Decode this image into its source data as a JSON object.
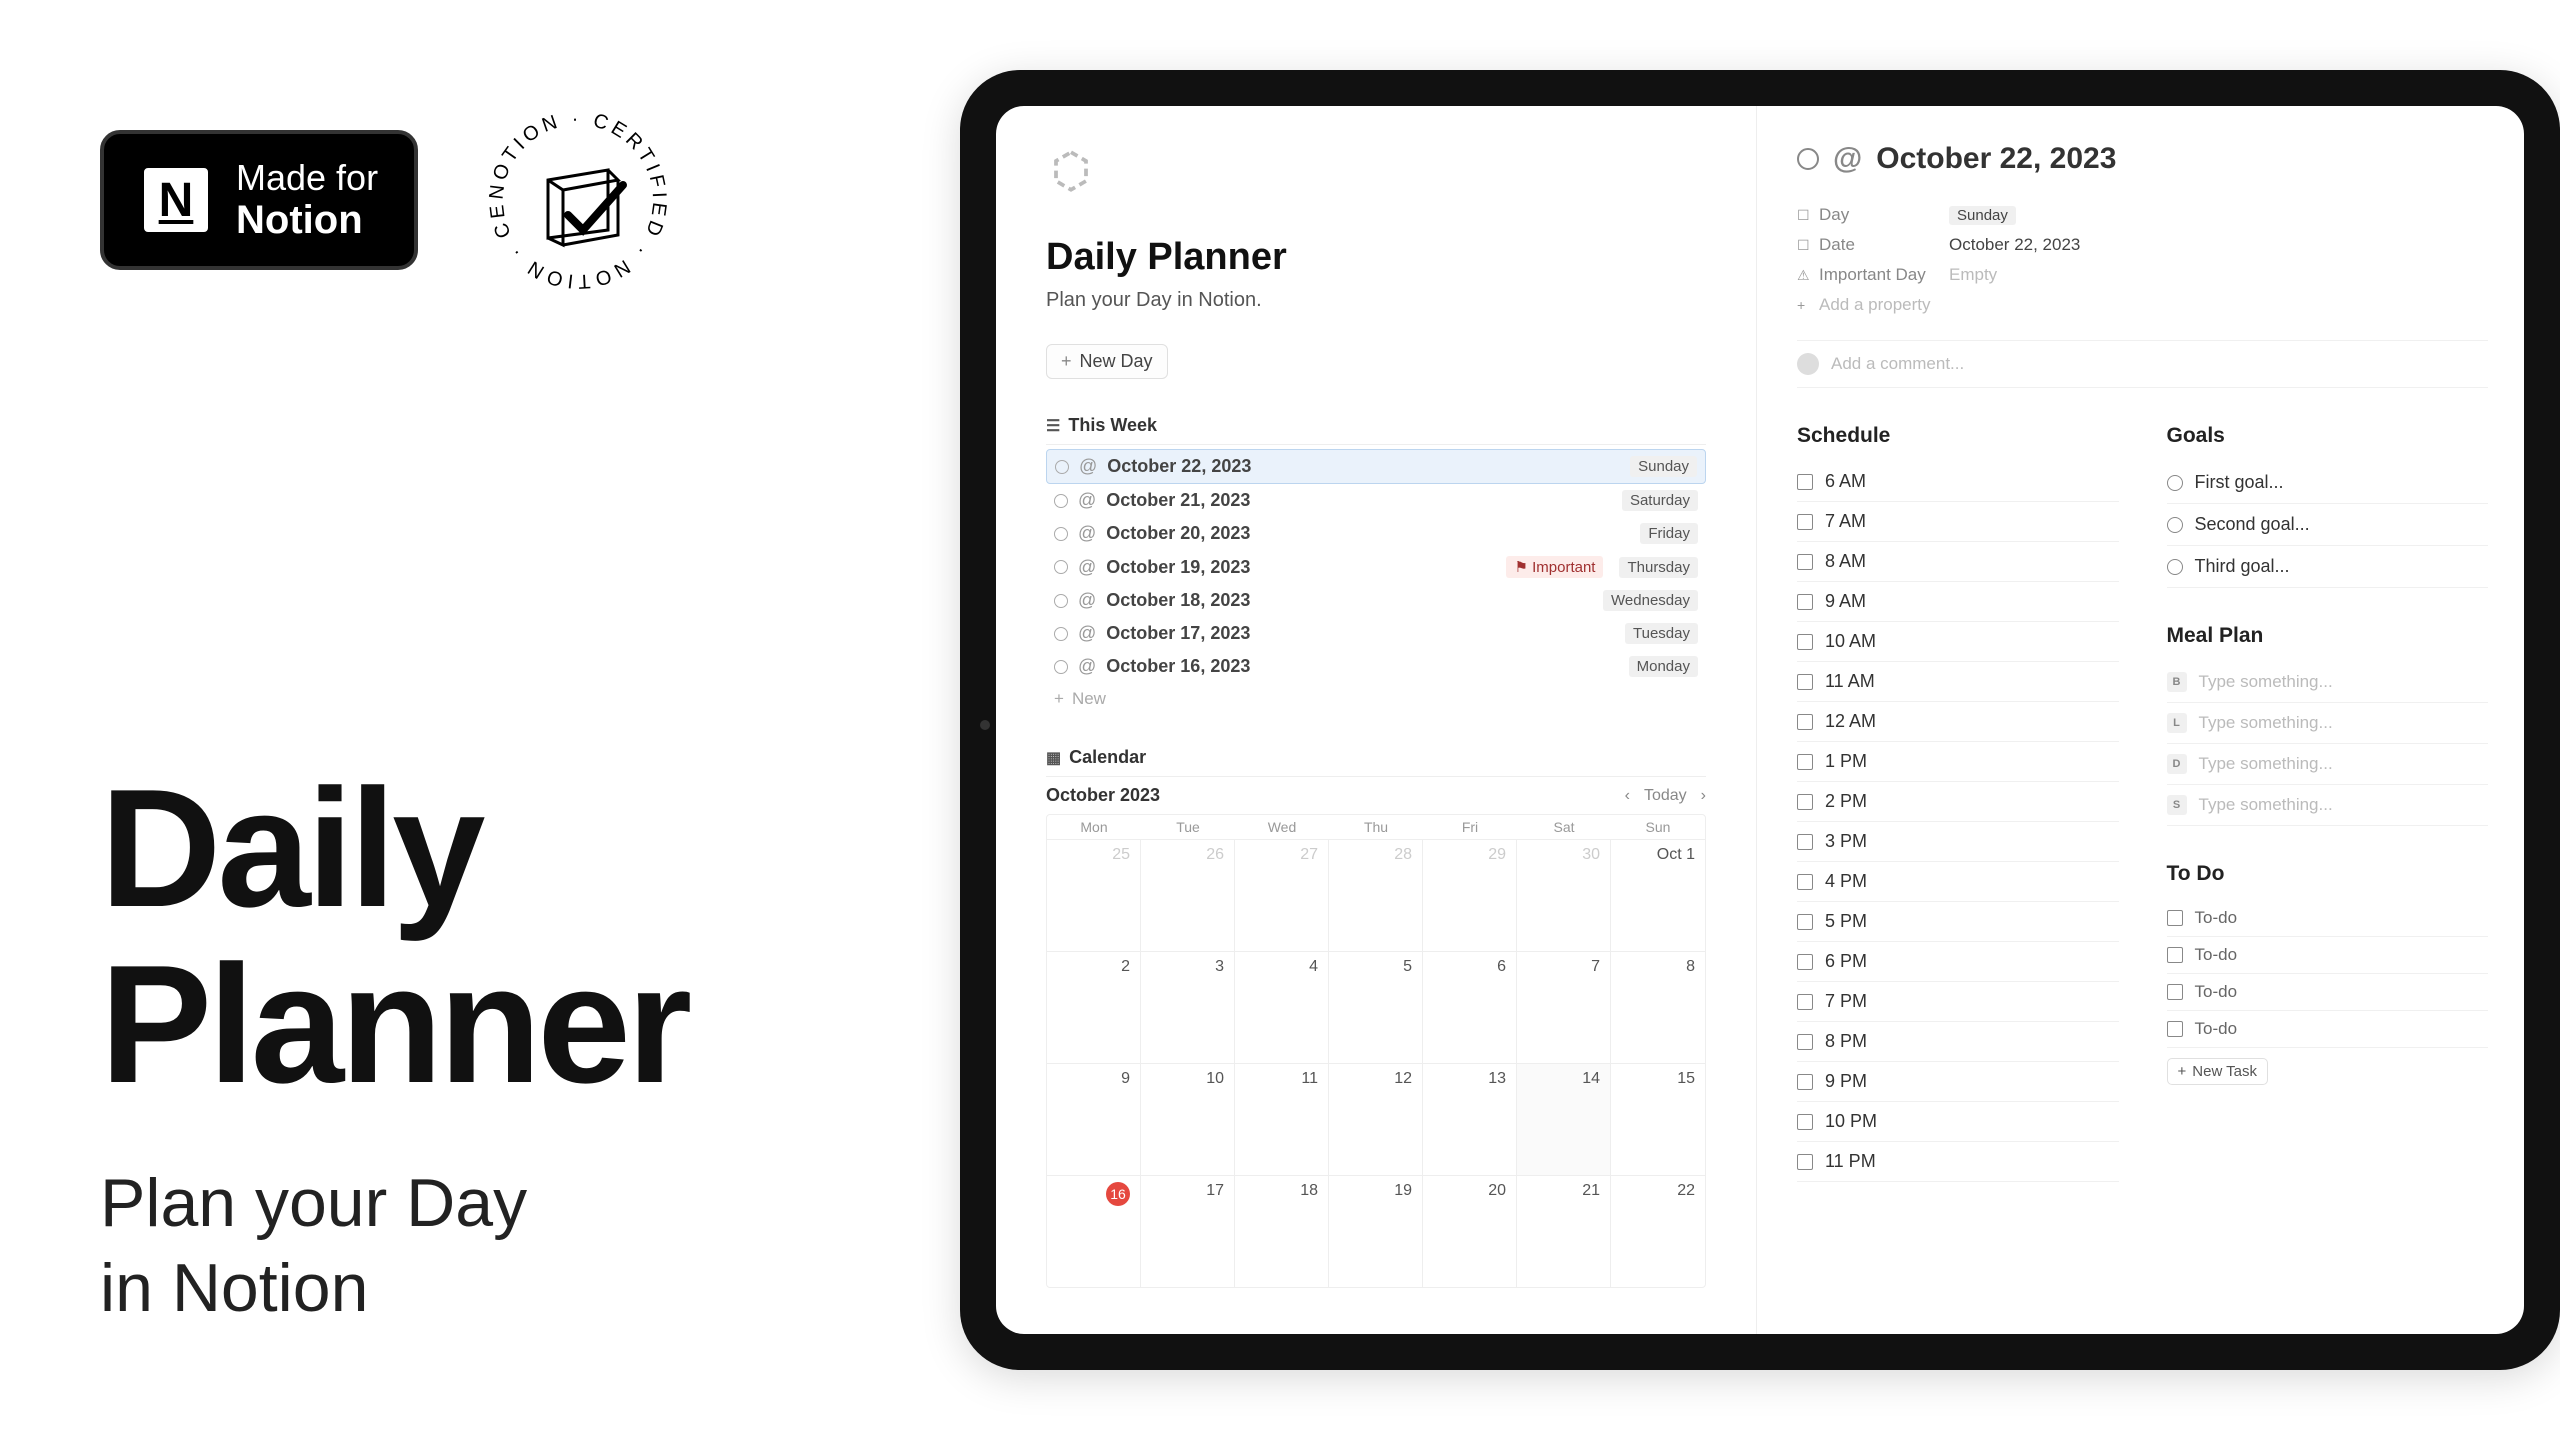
{
  "marketing": {
    "badge_made": "Made for",
    "badge_notion": "Notion",
    "hero_title1": "Daily",
    "hero_title2": "Planner",
    "hero_sub1": "Plan your Day",
    "hero_sub2": "in Notion"
  },
  "main": {
    "title": "Daily Planner",
    "subtitle": "Plan your Day in Notion.",
    "new_day": "New Day",
    "this_week": "This Week",
    "week": [
      {
        "date": "October 22, 2023",
        "day": "Sunday",
        "active": true
      },
      {
        "date": "October 21, 2023",
        "day": "Saturday"
      },
      {
        "date": "October 20, 2023",
        "day": "Friday"
      },
      {
        "date": "October 19, 2023",
        "day": "Thursday",
        "important": "Important"
      },
      {
        "date": "October 18, 2023",
        "day": "Wednesday"
      },
      {
        "date": "October 17, 2023",
        "day": "Tuesday"
      },
      {
        "date": "October 16, 2023",
        "day": "Monday"
      }
    ],
    "new_label": "New",
    "calendar_label": "Calendar",
    "month": "October 2023",
    "today": "Today",
    "daynames": [
      "Mon",
      "Tue",
      "Wed",
      "Thu",
      "Fri",
      "Sat",
      "Sun"
    ],
    "cells": [
      {
        "d": "25",
        "prev": true
      },
      {
        "d": "26",
        "prev": true
      },
      {
        "d": "27",
        "prev": true
      },
      {
        "d": "28",
        "prev": true
      },
      {
        "d": "29",
        "prev": true
      },
      {
        "d": "30",
        "prev": true
      },
      {
        "d": "Oct 1"
      },
      {
        "d": "2"
      },
      {
        "d": "3"
      },
      {
        "d": "4"
      },
      {
        "d": "5"
      },
      {
        "d": "6"
      },
      {
        "d": "7"
      },
      {
        "d": "8"
      },
      {
        "d": "9"
      },
      {
        "d": "10"
      },
      {
        "d": "11"
      },
      {
        "d": "12"
      },
      {
        "d": "13"
      },
      {
        "d": "14",
        "hl": true
      },
      {
        "d": "15"
      },
      {
        "d": "16",
        "badge": true
      },
      {
        "d": "17"
      },
      {
        "d": "18"
      },
      {
        "d": "19"
      },
      {
        "d": "20"
      },
      {
        "d": "21"
      },
      {
        "d": "22"
      }
    ]
  },
  "detail": {
    "title_date": "October 22, 2023",
    "props": {
      "day_label": "Day",
      "day_val": "Sunday",
      "date_label": "Date",
      "date_val": "October 22, 2023",
      "imp_label": "Important Day",
      "imp_val": "Empty",
      "add_prop": "Add a property"
    },
    "comment_placeholder": "Add a comment...",
    "schedule_title": "Schedule",
    "schedule": [
      "6 AM",
      "7 AM",
      "8 AM",
      "9 AM",
      "10 AM",
      "11 AM",
      "12 AM",
      "1 PM",
      "2 PM",
      "3 PM",
      "4 PM",
      "5 PM",
      "6 PM",
      "7 PM",
      "8 PM",
      "9 PM",
      "10 PM",
      "11 PM"
    ],
    "goals_title": "Goals",
    "goals": [
      "First goal...",
      "Second goal...",
      "Third goal..."
    ],
    "meal_title": "Meal Plan",
    "meals": [
      {
        "l": "B",
        "t": "Type something..."
      },
      {
        "l": "L",
        "t": "Type something..."
      },
      {
        "l": "D",
        "t": "Type something..."
      },
      {
        "l": "S",
        "t": "Type something..."
      }
    ],
    "todo_title": "To Do",
    "todos": [
      "To-do",
      "To-do",
      "To-do",
      "To-do"
    ],
    "new_task": "New Task"
  }
}
